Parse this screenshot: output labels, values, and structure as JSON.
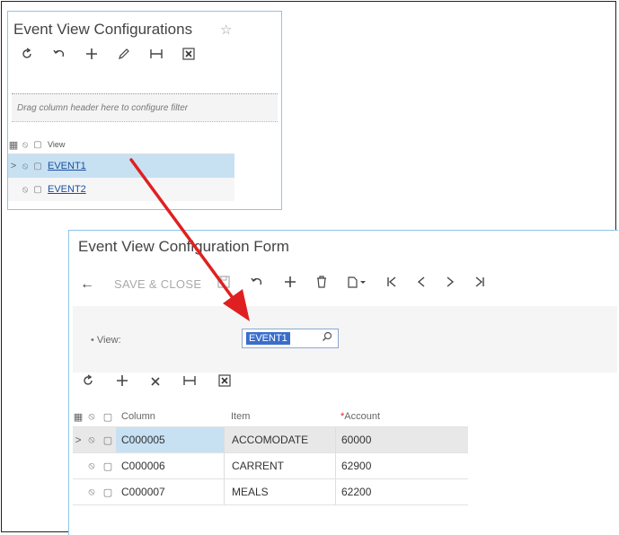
{
  "top_panel": {
    "title": "Event View Configurations",
    "star": "☆",
    "toolbar_icons": [
      "refresh-icon",
      "undo-icon",
      "add-icon",
      "edit-icon",
      "fit-columns-icon",
      "export-excel-icon"
    ],
    "filter_hint": "Drag column header here to configure filter",
    "grid": {
      "header": "View",
      "rows": [
        {
          "expander": ">",
          "value": "EVENT1",
          "selected": true
        },
        {
          "expander": "",
          "value": "EVENT2",
          "selected": false
        }
      ]
    }
  },
  "bottom_panel": {
    "title": "Event View Configuration Form",
    "toolbar": {
      "back": "←",
      "save_close": "SAVE & CLOSE",
      "icons": [
        "save-icon",
        "undo-icon",
        "add-icon",
        "delete-icon",
        "copy-paste-icon",
        "first-icon",
        "previous-icon",
        "next-icon",
        "last-icon"
      ]
    },
    "form": {
      "view_label": "View:",
      "view_value": "EVENT1"
    },
    "grid_toolbar": [
      "refresh-icon",
      "add-icon",
      "delete-icon",
      "fit-columns-icon",
      "export-excel-icon"
    ],
    "grid": {
      "headers": {
        "column": "Column",
        "item": "Item",
        "account": "Account",
        "account_required": "*"
      },
      "rows": [
        {
          "column": "C000005",
          "item": "ACCOMODATE",
          "account": "60000",
          "expander": ">"
        },
        {
          "column": "C000006",
          "item": "CARRENT",
          "account": "62900",
          "expander": ""
        },
        {
          "column": "C000007",
          "item": "MEALS",
          "account": "62200",
          "expander": ""
        }
      ]
    }
  },
  "colors": {
    "accent": "#8ec5e8",
    "selected_row": "#c7e1f3",
    "link": "#1a4fa0",
    "arrow": "#e02020",
    "input_highlight": "#3a6ecc"
  }
}
